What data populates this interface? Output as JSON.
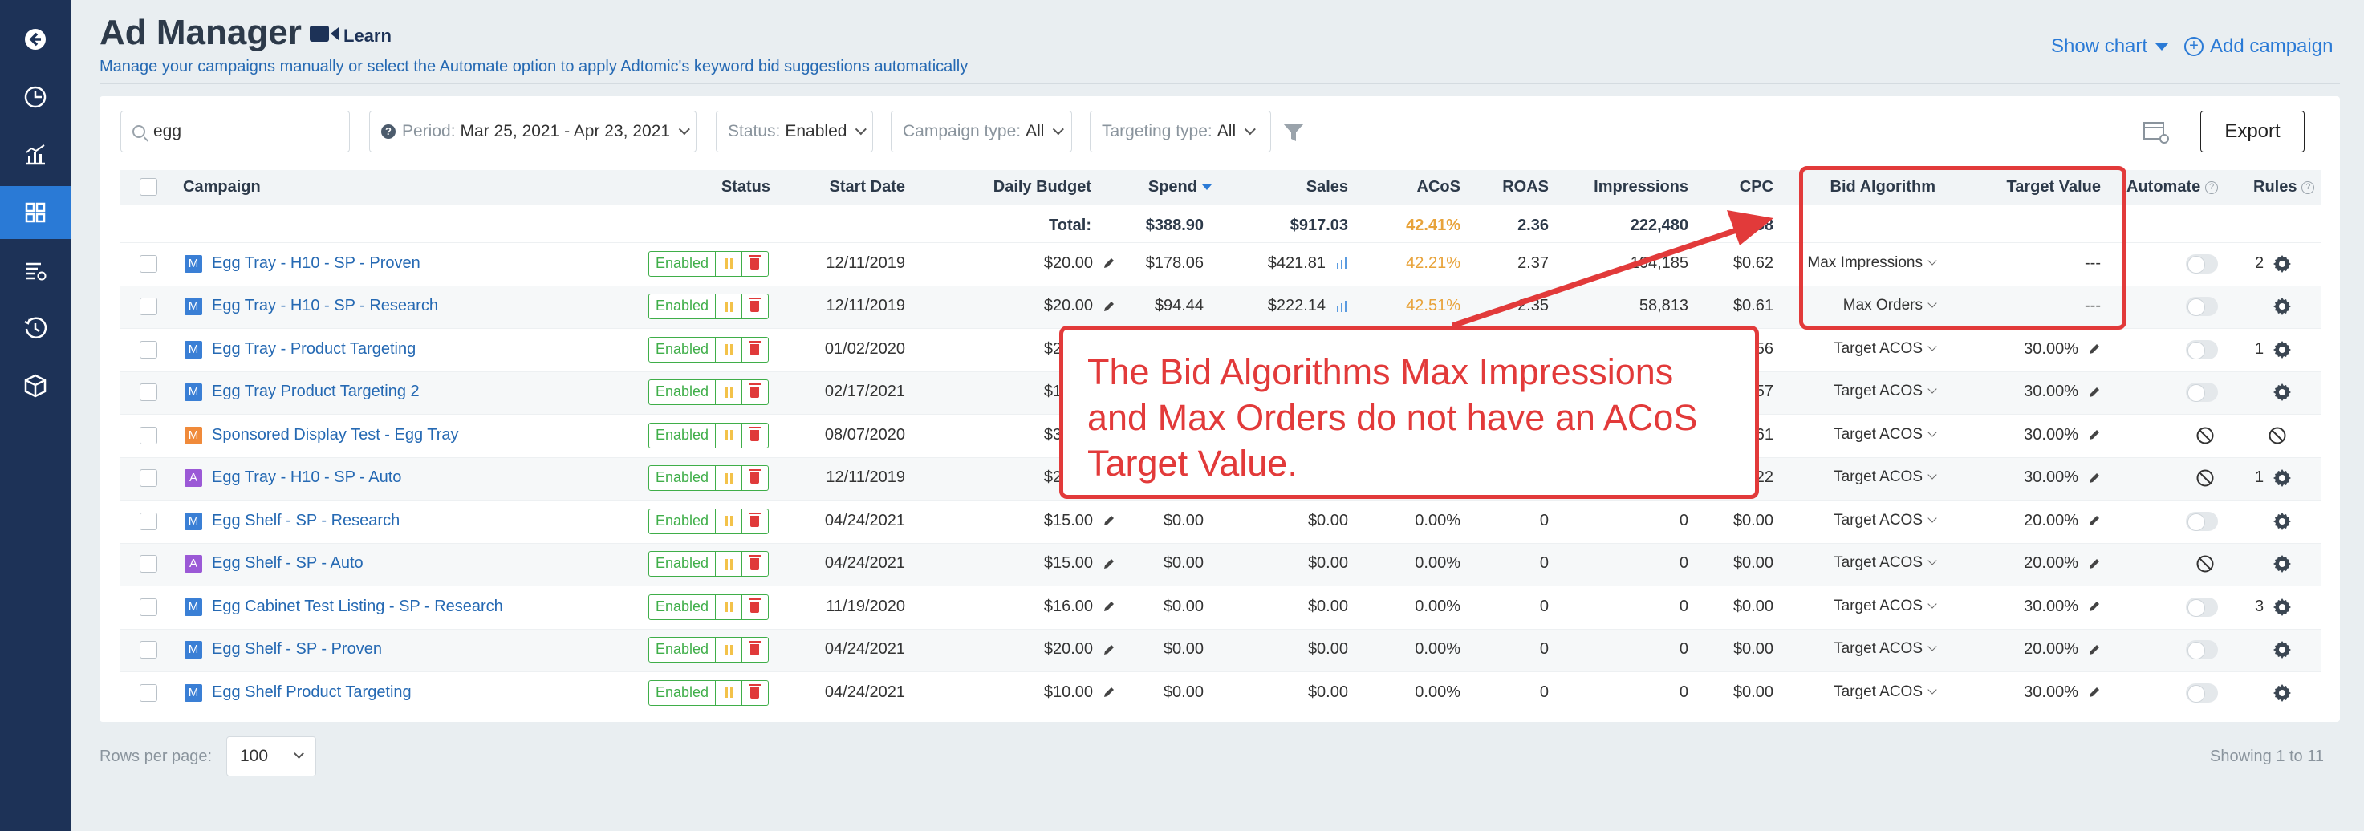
{
  "header": {
    "title": "Ad Manager",
    "learn_label": "Learn",
    "subtitle": "Manage your campaigns manually or select the Automate option to apply Adtomic's keyword bid suggestions automatically",
    "show_chart_label": "Show chart",
    "add_campaign_label": "Add campaign"
  },
  "sidebar": {
    "items": [
      {
        "icon": "back-arrow-icon"
      },
      {
        "icon": "clock-chart-icon"
      },
      {
        "icon": "analytics-chart-icon"
      },
      {
        "icon": "grid-icon",
        "active": true
      },
      {
        "icon": "list-settings-icon"
      },
      {
        "icon": "history-icon"
      },
      {
        "icon": "box-icon"
      }
    ]
  },
  "filters": {
    "search_value": "egg",
    "period_label": "Period:",
    "period_value": "Mar 25, 2021 - Apr 23, 2021",
    "status_label": "Status:",
    "status_value": "Enabled",
    "campaign_type_label": "Campaign type:",
    "campaign_type_value": "All",
    "targeting_type_label": "Targeting type:",
    "targeting_type_value": "All",
    "export_label": "Export"
  },
  "table": {
    "columns": {
      "campaign": "Campaign",
      "status": "Status",
      "start_date": "Start Date",
      "daily_budget": "Daily Budget",
      "spend": "Spend",
      "sales": "Sales",
      "acos": "ACoS",
      "roas": "ROAS",
      "impressions": "Impressions",
      "cpc": "CPC",
      "bid_algorithm": "Bid Algorithm",
      "target_value": "Target Value",
      "automate": "Automate",
      "rules": "Rules"
    },
    "totals": {
      "label": "Total:",
      "spend": "$388.90",
      "sales": "$917.03",
      "acos": "42.41%",
      "roas": "2.36",
      "impressions": "222,480",
      "cpc": "$0.58"
    },
    "rows": [
      {
        "badge": "M",
        "badge_color": "#3a7fd5",
        "name": "Egg Tray - H10 - SP - Proven",
        "status": "Enabled",
        "start": "12/11/2019",
        "budget": "$20.00",
        "spend": "$178.06",
        "sales": "$421.81",
        "acos": "42.21%",
        "acos_color": "#e8a33a",
        "roas": "2.37",
        "impr": "104,185",
        "cpc": "$0.62",
        "algo": "Max Impressions",
        "target": "---",
        "automate": "toggle",
        "rules": "2"
      },
      {
        "badge": "M",
        "badge_color": "#3a7fd5",
        "name": "Egg Tray - H10 - SP - Research",
        "status": "Enabled",
        "start": "12/11/2019",
        "budget": "$20.00",
        "spend": "$94.44",
        "sales": "$222.14",
        "acos": "42.51%",
        "acos_color": "#e8a33a",
        "roas": "2.35",
        "impr": "58,813",
        "cpc": "$0.61",
        "algo": "Max Orders",
        "target": "---",
        "automate": "toggle",
        "rules": ""
      },
      {
        "badge": "M",
        "badge_color": "#3a7fd5",
        "name": "Egg Tray - Product Targeting",
        "status": "Enabled",
        "start": "01/02/2020",
        "budget": "$20.00",
        "spend": "",
        "sales": "",
        "acos": "",
        "acos_color": "#333333",
        "roas": "",
        "impr": "",
        "cpc": "$0.56",
        "algo": "Target ACOS",
        "target": "30.00%",
        "automate": "toggle",
        "rules": "1"
      },
      {
        "badge": "M",
        "badge_color": "#3a7fd5",
        "name": "Egg Tray Product Targeting 2",
        "status": "Enabled",
        "start": "02/17/2021",
        "budget": "$10.00",
        "spend": "",
        "sales": "",
        "acos": "",
        "acos_color": "#333333",
        "roas": "",
        "impr": "",
        "cpc": "$0.57",
        "algo": "Target ACOS",
        "target": "30.00%",
        "automate": "toggle",
        "rules": ""
      },
      {
        "badge": "M",
        "badge_color": "#f08a3a",
        "name": "Sponsored Display Test - Egg Tray",
        "status": "Enabled",
        "start": "08/07/2020",
        "budget": "$30.00",
        "spend": "",
        "sales": "",
        "acos": "",
        "acos_color": "#333333",
        "roas": "",
        "impr": "",
        "cpc": "$0.61",
        "algo": "Target ACOS",
        "target": "30.00%",
        "automate": "blocked",
        "rules": "blocked"
      },
      {
        "badge": "A",
        "badge_color": "#9b59d6",
        "name": "Egg Tray - H10 - SP - Auto",
        "status": "Enabled",
        "start": "12/11/2019",
        "budget": "$20.00",
        "spend": "",
        "sales": "",
        "acos": "",
        "acos_color": "#333333",
        "roas": "",
        "impr": "",
        "cpc": "$0.22",
        "algo": "Target ACOS",
        "target": "30.00%",
        "automate": "blocked",
        "rules": "1"
      },
      {
        "badge": "M",
        "badge_color": "#3a7fd5",
        "name": "Egg Shelf - SP - Research",
        "status": "Enabled",
        "start": "04/24/2021",
        "budget": "$15.00",
        "spend": "$0.00",
        "sales": "$0.00",
        "acos": "0.00%",
        "acos_color": "#333333",
        "roas": "0",
        "impr": "0",
        "cpc": "$0.00",
        "algo": "Target ACOS",
        "target": "20.00%",
        "automate": "toggle",
        "rules": ""
      },
      {
        "badge": "A",
        "badge_color": "#9b59d6",
        "name": "Egg Shelf - SP - Auto",
        "status": "Enabled",
        "start": "04/24/2021",
        "budget": "$15.00",
        "spend": "$0.00",
        "sales": "$0.00",
        "acos": "0.00%",
        "acos_color": "#333333",
        "roas": "0",
        "impr": "0",
        "cpc": "$0.00",
        "algo": "Target ACOS",
        "target": "20.00%",
        "automate": "blocked",
        "rules": ""
      },
      {
        "badge": "M",
        "badge_color": "#3a7fd5",
        "name": "Egg Cabinet Test Listing - SP - Research",
        "status": "Enabled",
        "start": "11/19/2020",
        "budget": "$16.00",
        "spend": "$0.00",
        "sales": "$0.00",
        "acos": "0.00%",
        "acos_color": "#333333",
        "roas": "0",
        "impr": "0",
        "cpc": "$0.00",
        "algo": "Target ACOS",
        "target": "30.00%",
        "automate": "toggle",
        "rules": "3"
      },
      {
        "badge": "M",
        "badge_color": "#3a7fd5",
        "name": "Egg Shelf - SP - Proven",
        "status": "Enabled",
        "start": "04/24/2021",
        "budget": "$20.00",
        "spend": "$0.00",
        "sales": "$0.00",
        "acos": "0.00%",
        "acos_color": "#333333",
        "roas": "0",
        "impr": "0",
        "cpc": "$0.00",
        "algo": "Target ACOS",
        "target": "20.00%",
        "automate": "toggle",
        "rules": ""
      },
      {
        "badge": "M",
        "badge_color": "#3a7fd5",
        "name": "Egg Shelf Product Targeting",
        "status": "Enabled",
        "start": "04/24/2021",
        "budget": "$10.00",
        "spend": "$0.00",
        "sales": "$0.00",
        "acos": "0.00%",
        "acos_color": "#333333",
        "roas": "0",
        "impr": "0",
        "cpc": "$0.00",
        "algo": "Target ACOS",
        "target": "30.00%",
        "automate": "toggle",
        "rules": ""
      }
    ]
  },
  "footer": {
    "rows_per_page_label": "Rows per page:",
    "rows_per_page_value": "100",
    "showing": "Showing 1 to 11"
  },
  "annotation": {
    "text": "The Bid Algorithms Max Impressions and Max Orders do not have an ACoS Target Value.",
    "color": "#e23a3a"
  },
  "colors": {
    "sidebar": "#1d3257",
    "accent": "#2a7ad6",
    "enabled_green": "#3fae49",
    "acos_warning": "#e8a33a"
  }
}
